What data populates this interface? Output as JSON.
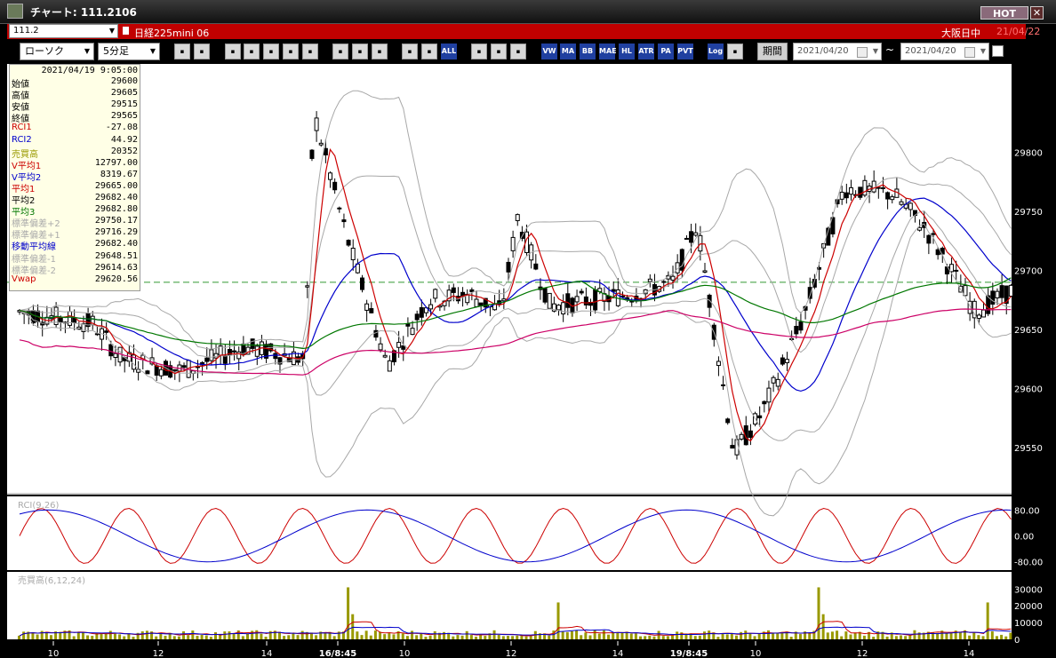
{
  "window": {
    "title": "チャート: 111.2106",
    "hot_label": "HOT",
    "close_label": "✕"
  },
  "instrument": {
    "code": "111.2",
    "name": "日経225mini 06",
    "session": "大阪日中",
    "date": "21/04/22"
  },
  "toolbar": {
    "chart_type": "ローソク",
    "timeframe": "5分足",
    "buttons": [
      "zoom",
      "bars",
      "cursor-cross",
      "find",
      "bar-chart",
      "cross",
      "info",
      "line-tool",
      "select-arrow",
      "undo",
      "box-left",
      "box-right",
      "all",
      "settings",
      "paint",
      "color",
      "vwap",
      "ma",
      "bb",
      "mae",
      "hl",
      "atr",
      "para",
      "pvt",
      "log",
      "window"
    ],
    "text_buttons": {
      "vwap": "VW AP",
      "ma": "MA",
      "bb": "BB",
      "mae": "MAE",
      "hl": "HL",
      "atr": "ATR",
      "para": "PA RA",
      "pvt": "PVT",
      "log": "Log",
      "all": "ALL"
    },
    "period_label": "期間",
    "date_from": "2021/04/20",
    "date_to": "2021/04/20",
    "tilde": "~"
  },
  "info_panel": {
    "datetime": "2021/04/19 9:05:00",
    "rows": [
      {
        "label": "始値",
        "value": "29600",
        "color": "#000000"
      },
      {
        "label": "高値",
        "value": "29605",
        "color": "#000000"
      },
      {
        "label": "安値",
        "value": "29515",
        "color": "#000000"
      },
      {
        "label": "終値",
        "value": "29565",
        "color": "#000000"
      },
      {
        "label": "RCI1",
        "value": "-27.08",
        "color": "#cc0000"
      },
      {
        "label": "RCI2",
        "value": "44.92",
        "color": "#0000cc"
      },
      {
        "label": "売買高",
        "value": "20352",
        "color": "#999900"
      },
      {
        "label": "V平均1",
        "value": "12797.00",
        "color": "#cc0000"
      },
      {
        "label": "V平均2",
        "value": "8319.67",
        "color": "#0000cc"
      },
      {
        "label": "平均1",
        "value": "29665.00",
        "color": "#cc0000"
      },
      {
        "label": "平均2",
        "value": "29682.40",
        "color": "#000000"
      },
      {
        "label": "平均3",
        "value": "29682.80",
        "color": "#007700"
      },
      {
        "label": "標準偏差+2",
        "value": "29750.17",
        "color": "#aaaaaa"
      },
      {
        "label": "標準偏差+1",
        "value": "29716.29",
        "color": "#aaaaaa"
      },
      {
        "label": "移動平均線",
        "value": "29682.40",
        "color": "#0000cc"
      },
      {
        "label": "標準偏差-1",
        "value": "29648.51",
        "color": "#aaaaaa"
      },
      {
        "label": "標準偏差-2",
        "value": "29614.63",
        "color": "#aaaaaa"
      },
      {
        "label": "Vwap",
        "value": "29620.56",
        "color": "#cc0000"
      }
    ]
  },
  "price_axis": {
    "ticks": [
      "29800",
      "29750",
      "29700",
      "29650",
      "29600",
      "29550"
    ]
  },
  "rci_panel": {
    "label": "RCI(9,26)",
    "ticks": [
      "80.00",
      "0.00",
      "-80.00"
    ]
  },
  "volume_panel": {
    "label": "売買高(6,12,24)",
    "ticks": [
      "30000",
      "20000",
      "10000",
      "0"
    ]
  },
  "time_axis": {
    "labels": [
      "10",
      "12",
      "14",
      "16/8:45",
      "10",
      "12",
      "14",
      "19/8:45",
      "10",
      "12",
      "14"
    ],
    "bold": [
      "16/8:45",
      "19/8:45"
    ]
  },
  "colors": {
    "candle": "#000000",
    "ma_short": "#cc0000",
    "ma_mid": "#0000cc",
    "ma_long": "#007700",
    "vwap": "#cc0066",
    "bands": "#a8a8a8",
    "ref_line": "#339933",
    "volume_bar": "#999900"
  }
}
